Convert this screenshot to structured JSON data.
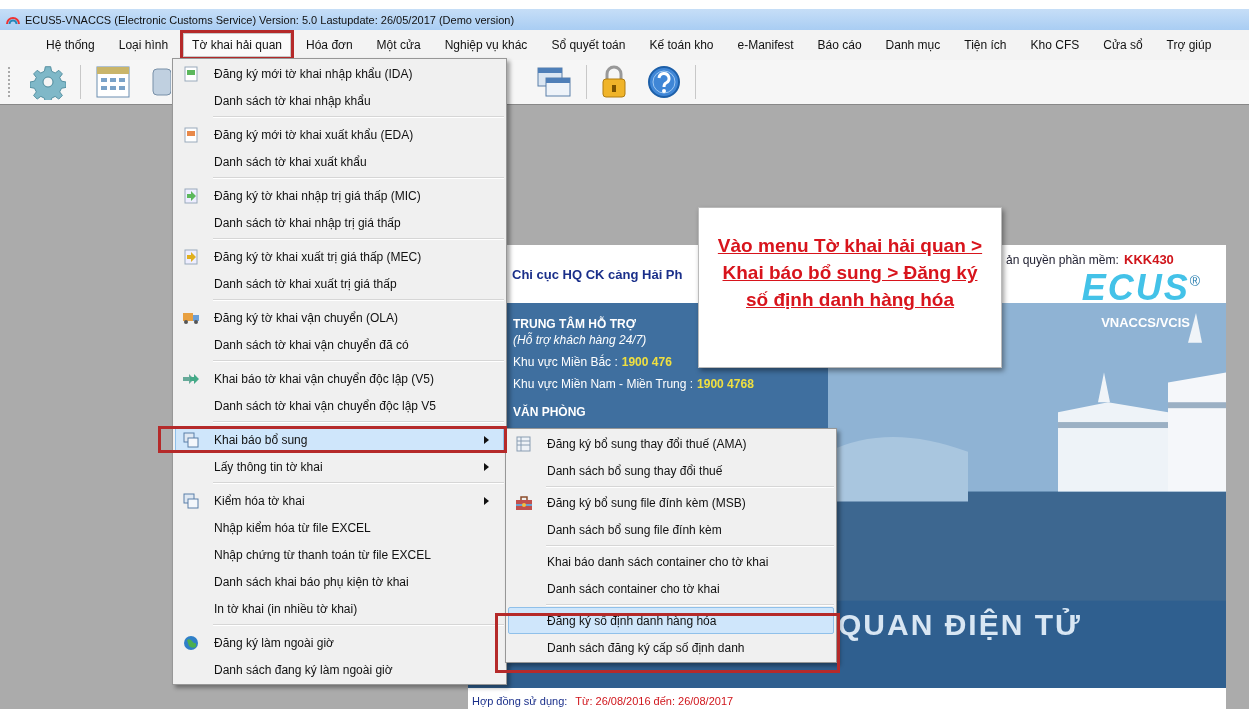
{
  "window": {
    "title": "ECUS5-VNACCS (Electronic Customs Service) Version: 5.0 Lastupdate: 26/05/2017 (Demo version)"
  },
  "menu_bar": [
    {
      "label": "Hệ thống",
      "selected": false
    },
    {
      "label": "Loại hình",
      "selected": false
    },
    {
      "label": "Tờ khai hải quan",
      "selected": true
    },
    {
      "label": "Hóa đơn",
      "selected": false
    },
    {
      "label": "Một cửa",
      "selected": false
    },
    {
      "label": "Nghiệp vụ khác",
      "selected": false
    },
    {
      "label": "Sổ quyết toán",
      "selected": false
    },
    {
      "label": "Kế toán kho",
      "selected": false
    },
    {
      "label": "e-Manifest",
      "selected": false
    },
    {
      "label": "Báo cáo",
      "selected": false
    },
    {
      "label": "Danh mục",
      "selected": false
    },
    {
      "label": "Tiện ích",
      "selected": false
    },
    {
      "label": "Kho CFS",
      "selected": false
    },
    {
      "label": "Cửa sổ",
      "selected": false
    },
    {
      "label": "Trợ giúp",
      "selected": false
    }
  ],
  "dropdown": {
    "groups": [
      [
        {
          "label": "Đăng ký mới tờ khai nhập khẩu (IDA)",
          "kind": "command",
          "selected": false
        },
        {
          "label": "Danh sách tờ khai nhập khẩu",
          "kind": "command",
          "selected": false
        }
      ],
      [
        {
          "label": "Đăng ký mới tờ khai xuất khẩu (EDA)",
          "kind": "command",
          "selected": false
        },
        {
          "label": "Danh sách tờ khai xuất khẩu",
          "kind": "command",
          "selected": false
        }
      ],
      [
        {
          "label": "Đăng ký tờ khai nhập trị giá thấp (MIC)",
          "kind": "command",
          "selected": false
        },
        {
          "label": "Danh sách tờ khai nhập trị giá thấp",
          "kind": "command",
          "selected": false
        }
      ],
      [
        {
          "label": "Đăng ký tờ khai xuất trị giá thấp (MEC)",
          "kind": "command",
          "selected": false
        },
        {
          "label": "Danh sách tờ khai xuất trị giá thấp",
          "kind": "command",
          "selected": false
        }
      ],
      [
        {
          "label": "Đăng ký tờ khai vận chuyển (OLA)",
          "kind": "command",
          "selected": false
        },
        {
          "label": "Danh sách tờ khai vận chuyển đã có",
          "kind": "command",
          "selected": false
        }
      ],
      [
        {
          "label": "Khai báo tờ khai vận chuyển độc lập (V5)",
          "kind": "command",
          "selected": false
        },
        {
          "label": "Danh sách tờ khai vận chuyển độc lập V5",
          "kind": "command",
          "selected": false
        }
      ],
      [
        {
          "label": "Khai báo bổ sung",
          "kind": "submenu",
          "selected": true
        },
        {
          "label": "Lấy thông tin tờ khai",
          "kind": "submenu",
          "selected": false
        }
      ],
      [
        {
          "label": "Kiểm hóa tờ khai",
          "kind": "submenu",
          "selected": false
        },
        {
          "label": "Nhập kiểm hóa từ file EXCEL",
          "kind": "command",
          "selected": false
        },
        {
          "label": "Nhập chứng từ thanh toán từ file EXCEL",
          "kind": "command",
          "selected": false
        },
        {
          "label": "Danh sách khai báo phụ kiện tờ khai",
          "kind": "command",
          "selected": false
        },
        {
          "label": "In tờ khai (in nhiều tờ khai)",
          "kind": "command",
          "selected": false
        }
      ],
      [
        {
          "label": "Đăng ký làm ngoài giờ",
          "kind": "command",
          "selected": false
        },
        {
          "label": "Danh sách đang ký làm ngoài giờ",
          "kind": "command",
          "selected": false
        }
      ]
    ]
  },
  "submenu": {
    "groups": [
      [
        {
          "label": "Đăng ký bổ sung thay đổi thuế (AMA)",
          "kind": "command",
          "selected": false
        },
        {
          "label": "Danh sách bổ sung thay đổi thuế",
          "kind": "command",
          "selected": false
        }
      ],
      [
        {
          "label": "Đăng ký bổ sung file đính kèm (MSB)",
          "kind": "command",
          "selected": false
        },
        {
          "label": "Danh sách bổ sung file đính kèm",
          "kind": "command",
          "selected": false
        }
      ],
      [
        {
          "label": "Khai báo danh sách container cho tờ khai",
          "kind": "command",
          "selected": false
        },
        {
          "label": "Danh sách container cho tờ khai",
          "kind": "command",
          "selected": false
        }
      ],
      [
        {
          "label": "Đăng ký số định danh hàng hóa",
          "kind": "command",
          "selected": true
        },
        {
          "label": "Danh sách đăng ký cấp số định danh",
          "kind": "command",
          "selected": false
        }
      ]
    ]
  },
  "callout": {
    "text": "Vào menu Tờ khai hải quan > Khai báo bổ sung > Đăng ký số định danh hàng hóa"
  },
  "splash": {
    "office": "Chi cục HQ CK cảng Hải Ph",
    "license_label": "ản quyền phần mềm:",
    "license_code": "KKK430",
    "logo": "ECUS",
    "logo_mark": "®",
    "logo_subtitle": "VNACCS/VCIS",
    "support_title": "TRUNG TÂM HỖ TRỢ",
    "support_note": "(Hỗ trợ khách hàng 24/7)",
    "hotlines": [
      {
        "label": "Khu vực Miền Bắc :",
        "number": "1900 476"
      },
      {
        "label": "Khu vực Miền Nam - Miền Trung :",
        "number": "1900 4768"
      }
    ],
    "office_title": "VĂN PHÒNG",
    "banner": "QUAN ĐIỆN TỬ",
    "contract_label": "Hợp đồng sử dụng:",
    "contract_value": "Từ: 26/08/2016 đến: 26/08/2017"
  }
}
